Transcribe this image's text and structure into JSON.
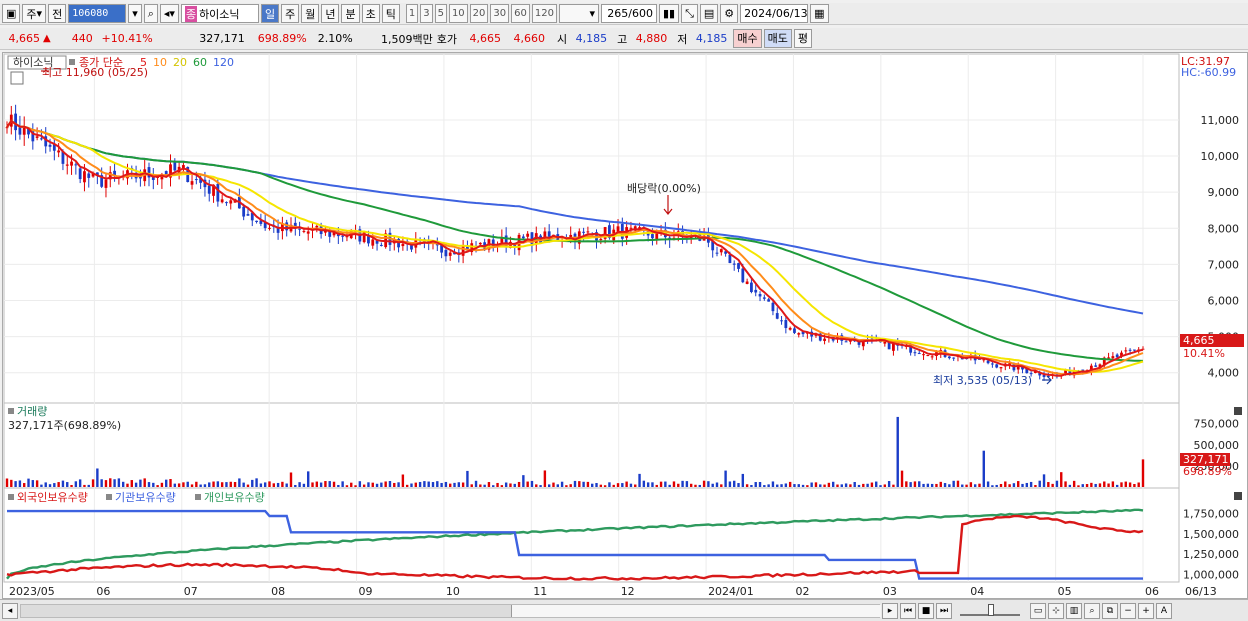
{
  "toolbar": {
    "market_label": "주",
    "prev_label": "전",
    "code": "106080",
    "stock_name": "하이소닉",
    "periods": [
      "일",
      "주",
      "월",
      "년",
      "분",
      "초",
      "틱"
    ],
    "period_selected": "일",
    "minute_options": [
      "1",
      "3",
      "5",
      "10",
      "20",
      "30",
      "60",
      "120"
    ],
    "count": "265",
    "count_total": "/600",
    "date": "2024/06/13"
  },
  "quote": {
    "price": "4,665",
    "arrow": "▲",
    "change": "440",
    "change_pct": "+10.41%",
    "volume": "327,171",
    "volume_ratio": "698.89%",
    "turnover": "2.10%",
    "amount": "1,509백만",
    "hoga_label": "호가",
    "ask": "4,665",
    "bid": "4,660",
    "open_label": "시",
    "open": "4,185",
    "high_label": "고",
    "high": "4,880",
    "low_label": "저",
    "low": "4,185",
    "buy_label": "매수",
    "sell_label": "매도",
    "eval_label": "평"
  },
  "colors": {
    "up": "#e00000",
    "down": "#1a3cc8",
    "ma5": "#e01818",
    "ma10": "#ff8c1a",
    "ma20": "#f5e600",
    "ma60": "#1f9a3a",
    "ma120": "#3d62e0",
    "foreign": "#d81818",
    "inst": "#3d62e0",
    "indiv": "#2e9a5e"
  },
  "price_panel": {
    "name": "하이소닉",
    "legend_prefix": "종가 단순",
    "ma_periods": [
      "5",
      "10",
      "20",
      "60",
      "120"
    ],
    "lc": "LC:31.97",
    "hc": "HC:-60.99",
    "high_note": "최고 11,960 (05/25)",
    "low_note": "최저 3,535 (05/13)",
    "dividend_note": "배당락(0.00%)",
    "last_price_tag": "4,665",
    "last_pct_tag": "10.41%"
  },
  "volume_panel": {
    "title": "거래량",
    "subtitle": "327,171주(698.89%)",
    "last_tag": "327,171",
    "last_pct_tag": "698.89%"
  },
  "holdings_panel": {
    "series_names": [
      "외국인보유수량",
      "기관보유수량",
      "개인보유수량"
    ]
  },
  "scrollbar_icons": [
    "left-arrow-icon",
    "right-arrow-icon",
    "first-icon",
    "stop-icon",
    "last-icon",
    "zoom-in-icon",
    "minus-icon",
    "plus-icon",
    "text-icon"
  ],
  "chart_data": [
    {
      "type": "candlestick",
      "title": "하이소닉",
      "x_labels": [
        "2023/05",
        "06",
        "07",
        "08",
        "09",
        "10",
        "11",
        "12",
        "2024/01",
        "02",
        "03",
        "04",
        "05",
        "06",
        "06/13"
      ],
      "y_ticks": [
        "11,000",
        "10,000",
        "9,000",
        "8,000",
        "7,000",
        "6,000",
        "5,000",
        "4,000"
      ],
      "ylim": [
        3300,
        12300
      ],
      "close_by_month": [
        {
          "x": "2023/05",
          "close": 11000
        },
        {
          "x": "06",
          "close": 9300
        },
        {
          "x": "07",
          "close": 9600
        },
        {
          "x": "08",
          "close": 8000
        },
        {
          "x": "09",
          "close": 7800
        },
        {
          "x": "10",
          "close": 7400
        },
        {
          "x": "11",
          "close": 7700
        },
        {
          "x": "12",
          "close": 7900
        },
        {
          "x": "2024/01",
          "close": 7700
        },
        {
          "x": "02",
          "close": 5100
        },
        {
          "x": "03",
          "close": 4800
        },
        {
          "x": "04",
          "close": 4400
        },
        {
          "x": "05",
          "close": 3900
        },
        {
          "x": "06",
          "close": 4665
        }
      ],
      "ma120_end": 5200,
      "ma60_end": 4400
    },
    {
      "type": "bar",
      "title": "거래량",
      "y_ticks": [
        "750,000",
        "500,000",
        "250,000"
      ],
      "ylim": [
        0,
        900000
      ],
      "notable_values": [
        {
          "x": "03",
          "value": 830000
        },
        {
          "x": "04",
          "value": 430000
        },
        {
          "x": "06/13",
          "value": 327171
        }
      ]
    },
    {
      "type": "line",
      "title": "외국인보유수량 · 기관보유수량 · 개인보유수량",
      "y_ticks": [
        "1,750,000",
        "1,500,000",
        "1,250,000",
        "1,000,000"
      ],
      "ylim": [
        920000,
        1880000
      ],
      "series": [
        {
          "name": "외국인보유수량",
          "start": 1000000,
          "end": 1620000
        },
        {
          "name": "기관보유수량",
          "start": 1780000,
          "end": 950000
        },
        {
          "name": "개인보유수량",
          "start": 950000,
          "end": 1790000
        }
      ]
    }
  ]
}
